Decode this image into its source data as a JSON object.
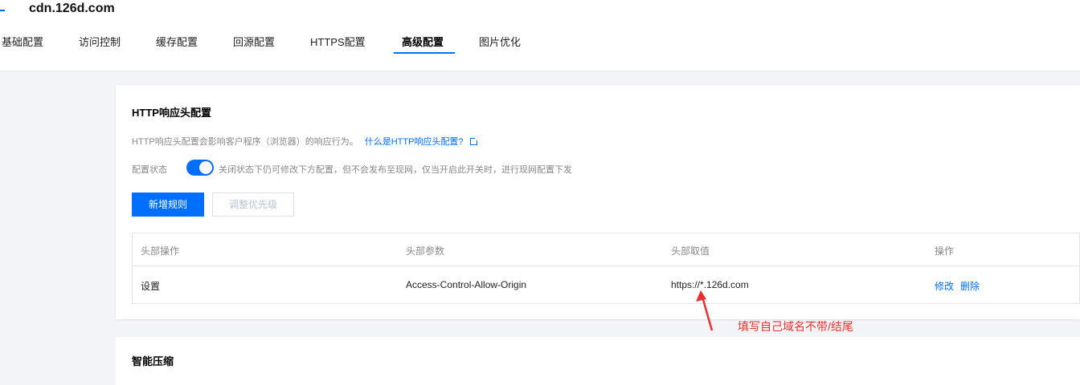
{
  "header": {
    "domain": "cdn.126d.com"
  },
  "tabs": [
    {
      "label": "基础配置",
      "active": false
    },
    {
      "label": "访问控制",
      "active": false
    },
    {
      "label": "缓存配置",
      "active": false
    },
    {
      "label": "回源配置",
      "active": false
    },
    {
      "label": "HTTPS配置",
      "active": false
    },
    {
      "label": "高级配置",
      "active": true
    },
    {
      "label": "图片优化",
      "active": false
    }
  ],
  "http_header_card": {
    "title": "HTTP响应头配置",
    "description": "HTTP响应头配置会影响客户程序（浏览器）的响应行为。",
    "help_link": "什么是HTTP响应头配置?",
    "status_label": "配置状态",
    "toggle_on": true,
    "status_hint": "关闭状态下仍可修改下方配置，但不会发布至现网，仅当开启此开关时，进行现网配置下发",
    "add_rule_button": "新增规则",
    "adjust_priority_button": "调整优先级",
    "table": {
      "columns": [
        "头部操作",
        "头部参数",
        "头部取值",
        "操作"
      ],
      "rows": [
        {
          "operation": "设置",
          "param": "Access-Control-Allow-Origin",
          "value": "https://*.126d.com",
          "actions": [
            "修改",
            "删除"
          ]
        }
      ]
    }
  },
  "next_card": {
    "title": "智能压缩"
  },
  "annotation": {
    "text": "填写自己域名不带/结尾",
    "color": "#e8312f"
  },
  "colors": {
    "accent": "#006eff",
    "annotation": "#e8312f"
  }
}
